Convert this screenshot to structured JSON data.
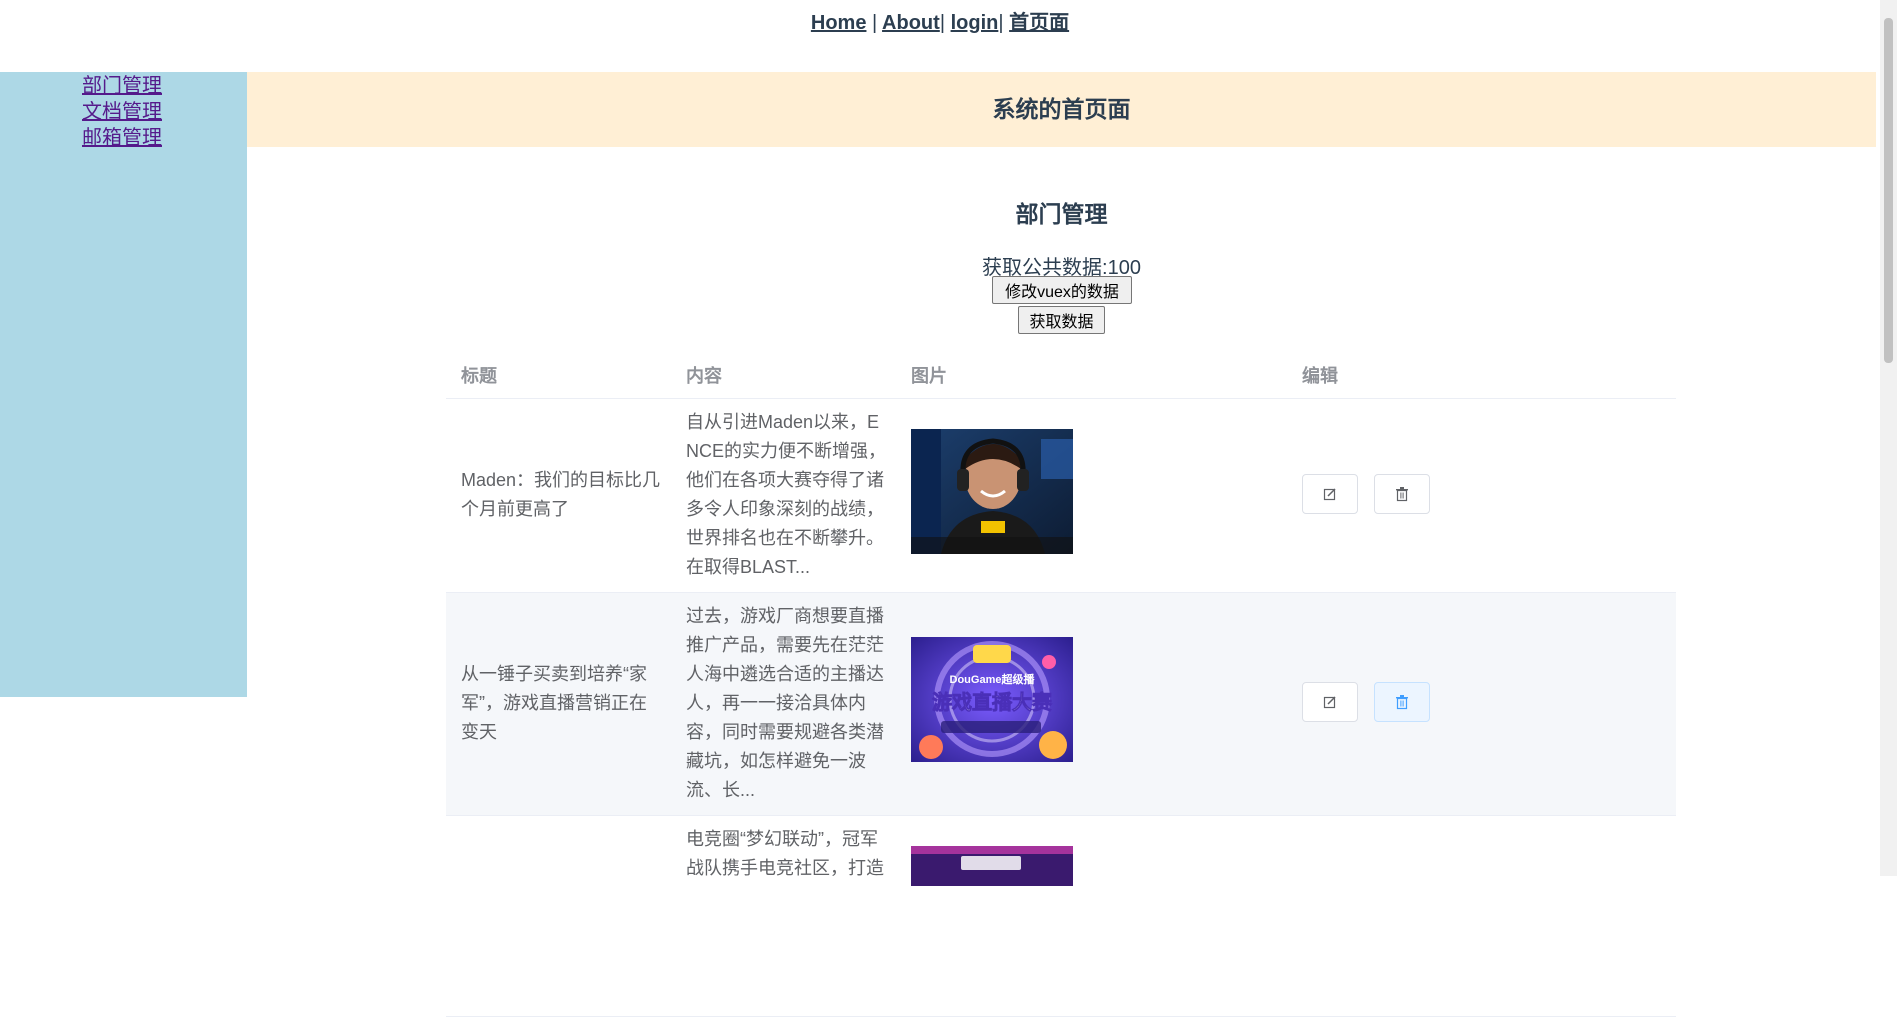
{
  "nav": {
    "home": "Home",
    "sep1": "|",
    "about": "About",
    "sep2": "|",
    "login": "login",
    "sep3": "|",
    "index": "首页面"
  },
  "sidebar": {
    "items": [
      {
        "label": "部门管理"
      },
      {
        "label": "文档管理"
      },
      {
        "label": "邮箱管理"
      }
    ]
  },
  "header": {
    "title": "系统的首页面"
  },
  "main": {
    "section_title": "部门管理",
    "public_data": "获取公共数据:100",
    "modify_button": "修改vuex的数据",
    "fetch_button": "获取数据"
  },
  "table": {
    "columns": [
      "标题",
      "内容",
      "图片",
      "编辑"
    ],
    "rows": [
      {
        "title": "Maden：我们的目标比几个月前更高了",
        "content": "自从引进Maden以来，ENCE的实力便不断增强，他们在各项大赛夺得了诸多令人印象深刻的战绩，世界排名也在不断攀升。在取得BLAST...",
        "image_icon": "esports-player-photo"
      },
      {
        "title": "从一锤子买卖到培养“家军”，游戏直播营销正在变天",
        "content": "过去，游戏厂商想要直播推广产品，需要先在茫茫人海中遴选合适的主播达人，再一一接洽具体内容，同时需要规避各类潜藏坑，如怎样避免一波流、长...",
        "image_icon": "game-livestream-poster",
        "image_text": "游戏直播大赛",
        "image_brand": "DouGame超级播"
      },
      {
        "title": "",
        "content": "电竞圈“梦幻联动”，冠军战队携手电竞社区，打造",
        "image_icon": "esports-event-poster"
      }
    ],
    "edit_icon": "edit-icon",
    "delete_icon": "delete-icon"
  }
}
